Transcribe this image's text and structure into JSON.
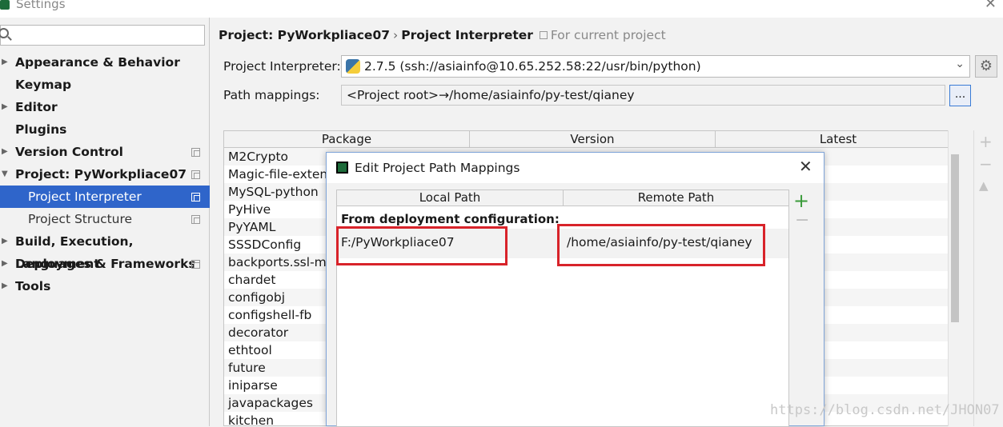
{
  "window": {
    "title": "Settings"
  },
  "sidebar": {
    "search_placeholder": "",
    "items": [
      {
        "label": "Appearance & Behavior",
        "expandable": true
      },
      {
        "label": "Keymap",
        "expandable": false
      },
      {
        "label": "Editor",
        "expandable": true
      },
      {
        "label": "Plugins",
        "expandable": false
      },
      {
        "label": "Version Control",
        "expandable": true
      },
      {
        "label": "Project: PyWorkpliace07",
        "expandable": true,
        "expanded": true
      },
      {
        "label": "Project Interpreter",
        "selected": true
      },
      {
        "label": "Project Structure"
      },
      {
        "label": "Build, Execution, Deployment",
        "expandable": true
      },
      {
        "label": "Languages & Frameworks",
        "expandable": true
      },
      {
        "label": "Tools",
        "expandable": true
      }
    ]
  },
  "breadcrumb": {
    "project": "Project: PyWorkpliace07",
    "separator": "›",
    "page": "Project Interpreter",
    "scope": "For current project"
  },
  "interpreter": {
    "label": "Project Interpreter:",
    "value": "2.7.5 (ssh://asiainfo@10.65.252.58:22/usr/bin/python)"
  },
  "path_mappings": {
    "label": "Path mappings:",
    "value": "<Project root>→/home/asiainfo/py-test/qianey",
    "button": "..."
  },
  "packages": {
    "columns": [
      "Package",
      "Version",
      "Latest"
    ],
    "rows": [
      "M2Crypto",
      "Magic-file-extens",
      "MySQL-python",
      "PyHive",
      "PyYAML",
      "SSSDConfig",
      "backports.ssl-ma",
      "chardet",
      "configobj",
      "configshell-fb",
      "decorator",
      "ethtool",
      "future",
      "iniparse",
      "javapackages",
      "kitchen"
    ],
    "tool_add": "+",
    "tool_remove": "−",
    "tool_upgrade": "▲"
  },
  "dialog": {
    "title": "Edit Project Path Mappings",
    "columns": [
      "Local Path",
      "Remote Path"
    ],
    "group": "From deployment configuration:",
    "mapping": {
      "local": "F:/PyWorkpliace07",
      "remote": "/home/asiainfo/py-test/qianey"
    },
    "add": "+",
    "remove": "−",
    "highlight_color": "#d8232a"
  },
  "watermark": "https://blog.csdn.net/JHON07"
}
